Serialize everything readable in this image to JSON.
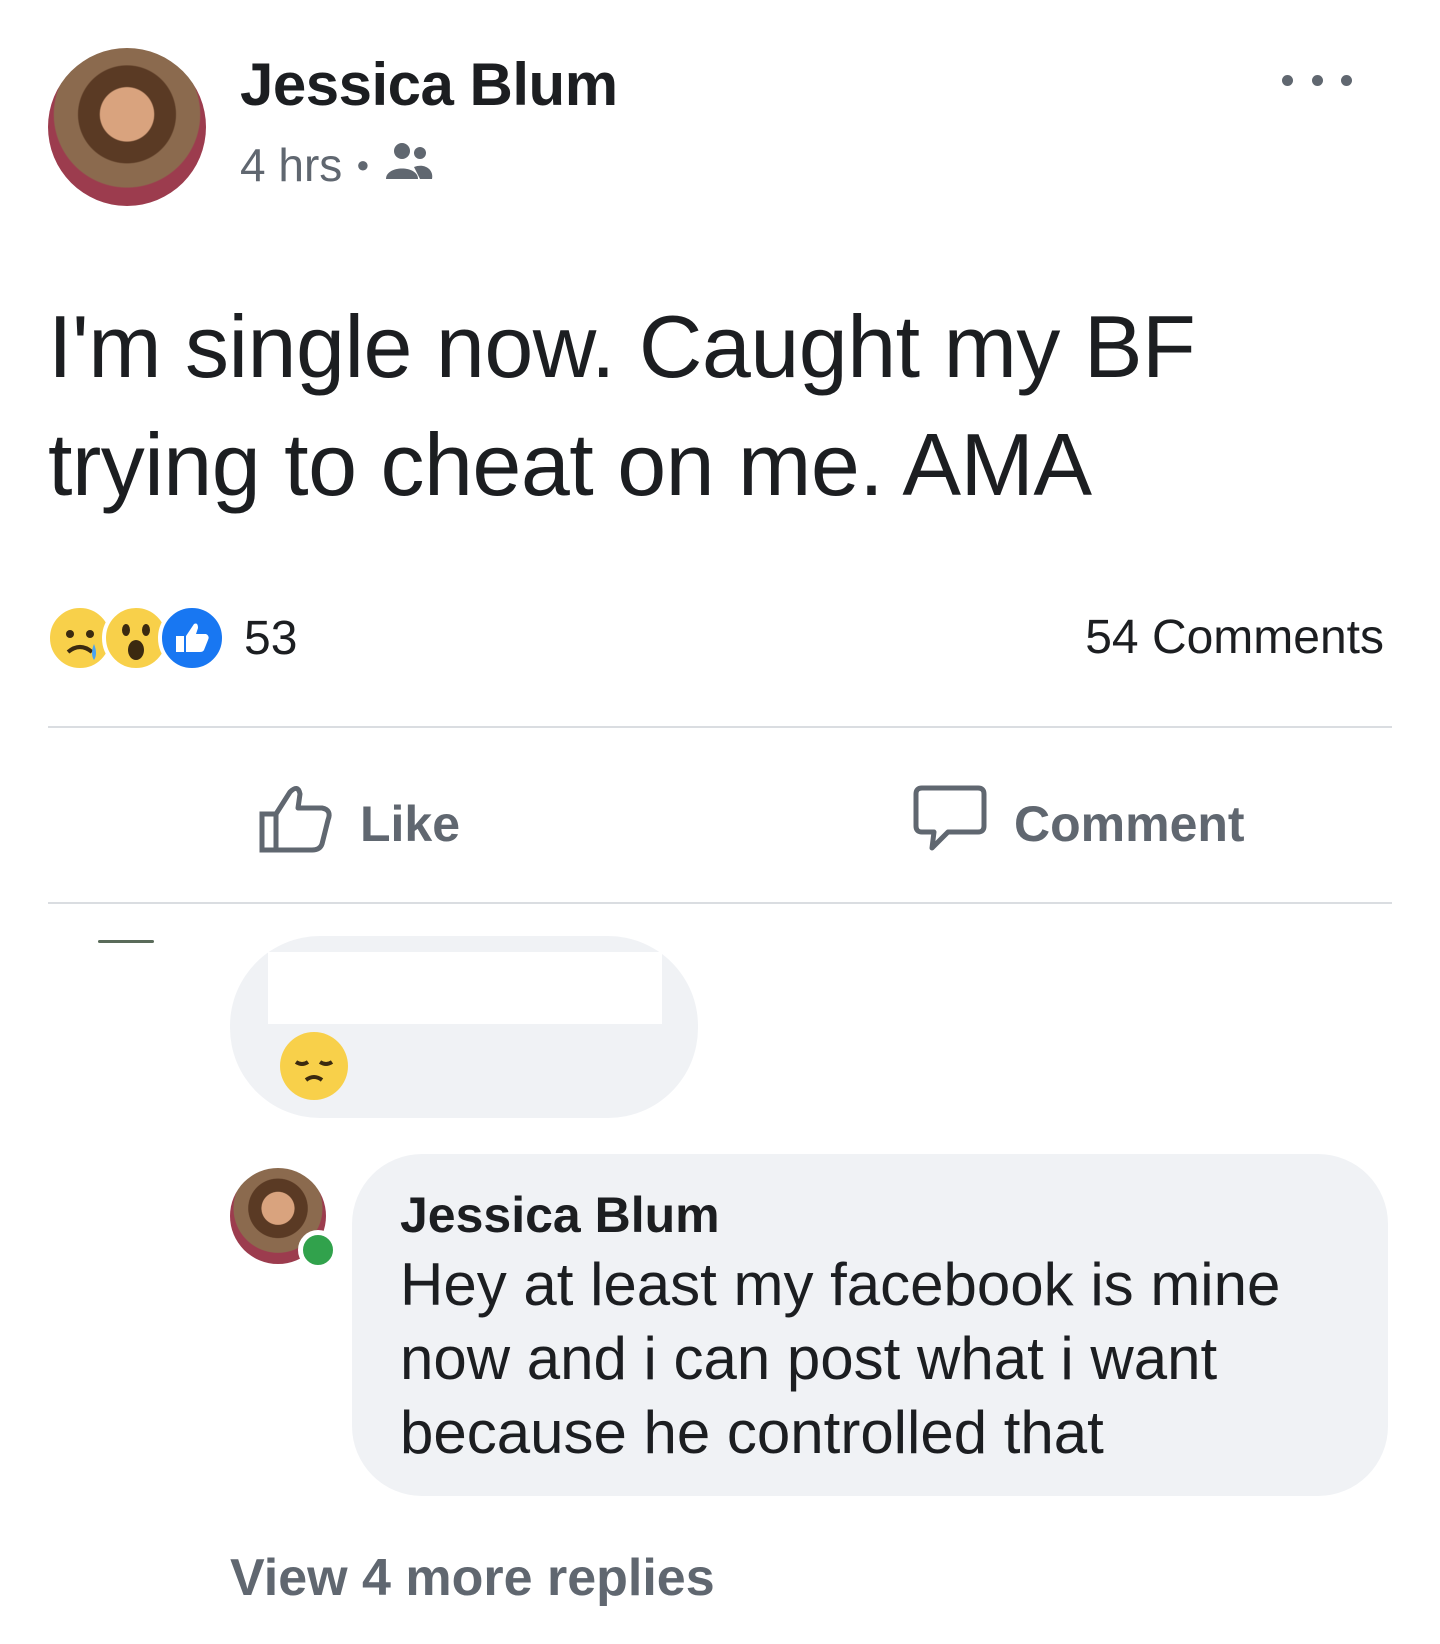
{
  "post": {
    "author": "Jessica Blum",
    "time": "4 hrs",
    "audience_icon": "friends-icon",
    "text": "I'm single now. Caught my BF trying to cheat on me. AMA",
    "reactions": {
      "icons": [
        "sad-reaction-icon",
        "wow-reaction-icon",
        "like-reaction-icon"
      ],
      "count": "53"
    },
    "comments_count": "54 Comments"
  },
  "actions": {
    "like": "Like",
    "comment": "Comment"
  },
  "comments": [
    {
      "author": "",
      "text": "",
      "emoji": "pensive-face-icon"
    },
    {
      "author": "Jessica Blum",
      "text": "Hey at least my facebook is mine now and i can post what i want because he controlled that",
      "online": true
    }
  ],
  "view_more": "View 4 more replies",
  "colors": {
    "text": "#1c1e21",
    "secondary": "#606770",
    "bubble": "#f0f2f5",
    "like_blue": "#1877f2",
    "online_green": "#31a24c",
    "emoji_yellow": "#f8d04a"
  }
}
